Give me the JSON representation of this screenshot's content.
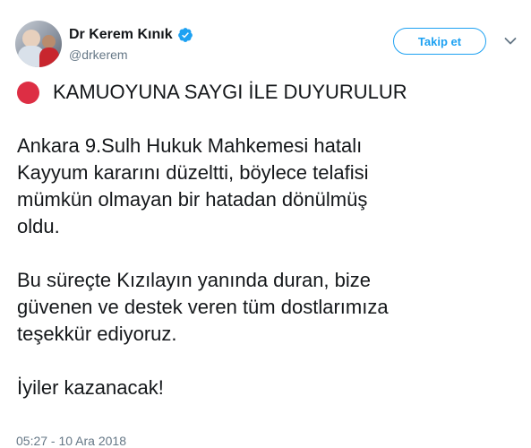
{
  "header": {
    "display_name": "Dr Kerem Kınık",
    "handle": "@drkerem",
    "follow_label": "Takip et",
    "verified_icon": "verified-badge-icon",
    "menu_icon": "chevron-down-icon"
  },
  "tweet": {
    "headline_icon": "red-circle-icon",
    "headline": "KAMUOYUNA SAYGI İLE DUYURULUR",
    "paragraph1": [
      "Ankara 9.Sulh Hukuk Mahkemesi hatalı",
      "Kayyum kararını düzeltti, böylece telafisi",
      "mümkün olmayan bir hatadan dönülmüş",
      "oldu."
    ],
    "paragraph2": [
      "Bu süreçte Kızılayın yanında duran, bize",
      "güvenen ve destek veren tüm dostlarımıza",
      "teşekkür ediyoruz."
    ],
    "closing": "İyiler kazanacak!",
    "timestamp": "05:27 - 10 Ara 2018"
  },
  "colors": {
    "accent": "#1da1f2",
    "text": "#14171a",
    "secondary_text": "#657786",
    "red_circle": "#dd2e44"
  }
}
